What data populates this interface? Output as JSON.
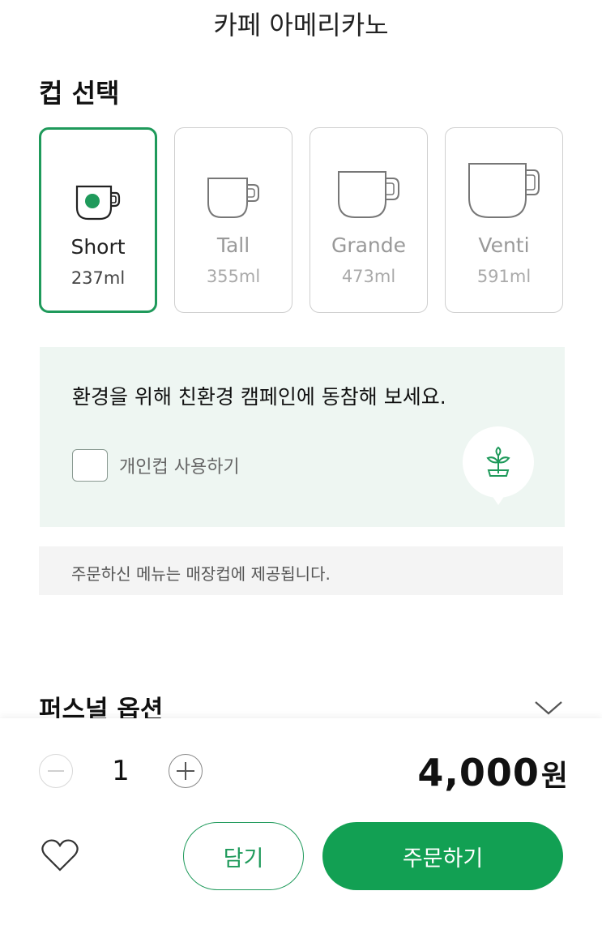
{
  "header": {
    "title": "카페 아메리카노"
  },
  "cup_section": {
    "heading": "컵 선택",
    "sizes": [
      {
        "name": "Short",
        "volume": "237ml",
        "selected": true
      },
      {
        "name": "Tall",
        "volume": "355ml",
        "selected": false
      },
      {
        "name": "Grande",
        "volume": "473ml",
        "selected": false
      },
      {
        "name": "Venti",
        "volume": "591ml",
        "selected": false
      }
    ]
  },
  "eco": {
    "message": "환경을 위해 친환경 캠페인에 동참해 보세요.",
    "checkbox_label": "개인컵 사용하기",
    "checked": false,
    "icon": "plant-icon"
  },
  "notice": {
    "text": "주문하신 메뉴는 매장컵에 제공됩니다."
  },
  "personal_options": {
    "title": "퍼스널 옵션",
    "icon": "chevron-down-icon"
  },
  "order_bar": {
    "quantity": "1",
    "price": "4,000",
    "currency": "원",
    "cart_label": "담기",
    "order_label": "주문하기",
    "favorite_icon": "heart-icon"
  },
  "colors": {
    "accent": "#1f9a5b",
    "order_button": "#12a053",
    "eco_background": "#eef6f2",
    "notice_background": "#f4f4f4"
  }
}
